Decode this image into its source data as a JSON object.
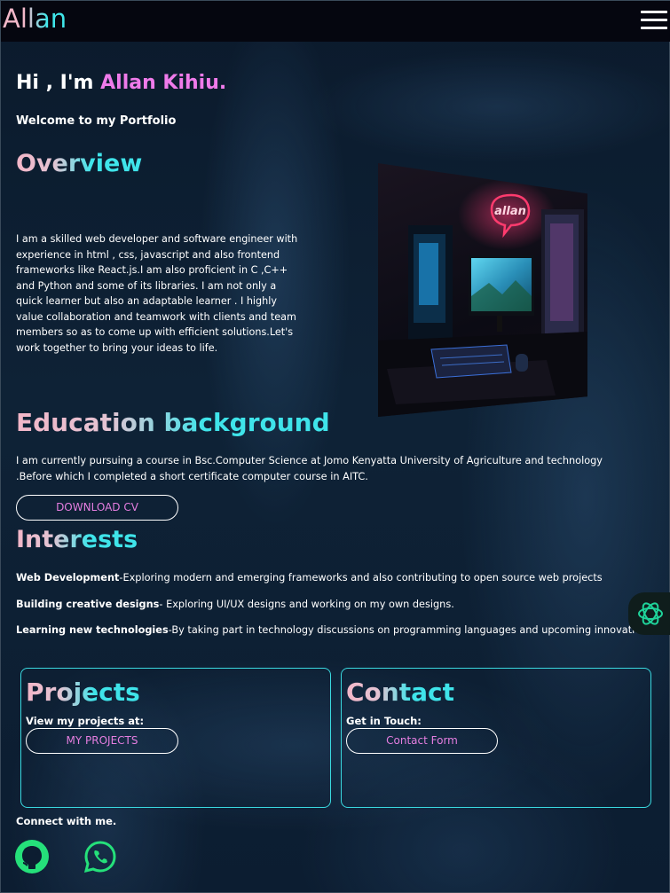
{
  "navbar": {
    "logo": "Allan",
    "menu_icon": "hamburger-menu-icon"
  },
  "hero": {
    "greeting": "Hi , I'm",
    "name": "Allan Kihiu.",
    "welcome": "Welcome to my Portfolio"
  },
  "overview": {
    "title": "Overview",
    "text": "I am a skilled web developer and software engineer with experience in html , css, javascript and also frontend frameworks like React.js.I am also proficient in C ,C++ and Python and some of its libraries. I am not only a quick learner but also an adaptable learner . I highly value collaboration and teamwork with clients and team members so as to come up with efficient solutions.Let's work together to bring your ideas to life.",
    "image_sign_text": "allan"
  },
  "education": {
    "title": "Education background",
    "text": "I am currently pursuing a course in Bsc.Computer Science at Jomo Kenyatta University of Agriculture and technology .Before which I completed a short certificate computer course in AITC.",
    "button": "DOWNLOAD CV"
  },
  "interests": {
    "title": "Interests",
    "items": [
      {
        "label": "Web Development",
        "text": "-Exploring modern and emerging frameworks and also contributing to open source web projects"
      },
      {
        "label": "Building creative designs",
        "text": "- Exploring UI/UX designs and working on my own designs."
      },
      {
        "label": "Learning new technologies",
        "text": "-By taking part in technology discussions on programming languages and upcoming innovations"
      }
    ]
  },
  "projects": {
    "title": "Projects",
    "subtitle": "View my projects at:",
    "button": "MY PROJECTS"
  },
  "contact": {
    "title": "Contact",
    "subtitle": "Get in Touch:",
    "button": "Contact Form"
  },
  "connect": {
    "label": "Connect with me.",
    "icons": [
      "github-icon",
      "whatsapp-icon"
    ]
  },
  "floating": {
    "icon": "chatgpt-icon"
  },
  "colors": {
    "accent_pink": "#ef7bea",
    "accent_cyan": "#3fe4ea",
    "navbar_bg": "#05060f",
    "social_green": "#25e07a"
  }
}
